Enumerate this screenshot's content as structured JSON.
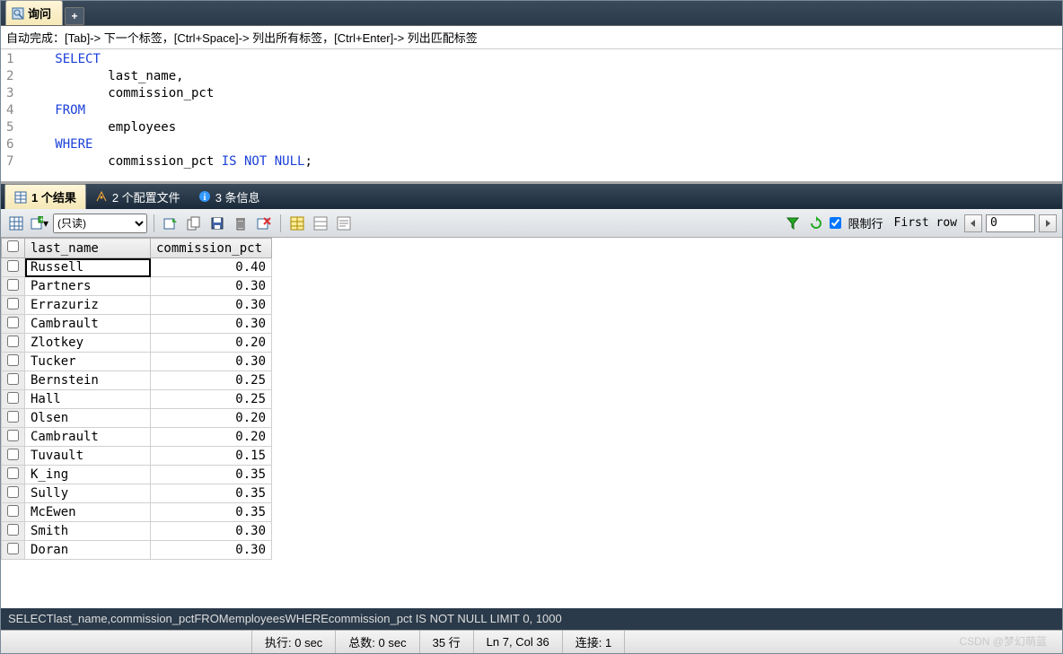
{
  "tabs": {
    "query_label": "询问"
  },
  "hint": "自动完成：[Tab]-> 下一个标签，[Ctrl+Space]-> 列出所有标签，[Ctrl+Enter]-> 列出匹配标签",
  "editor": {
    "lines": [
      "1",
      "2",
      "3",
      "4",
      "5",
      "6",
      "7"
    ],
    "code": [
      [
        {
          "t": "   "
        },
        {
          "t": "SELECT",
          "c": "kw"
        }
      ],
      [
        {
          "t": "          last_name,"
        }
      ],
      [
        {
          "t": "          commission_pct"
        }
      ],
      [
        {
          "t": "   "
        },
        {
          "t": "FROM",
          "c": "kw"
        }
      ],
      [
        {
          "t": "          employees"
        }
      ],
      [
        {
          "t": "   "
        },
        {
          "t": "WHERE",
          "c": "kw"
        }
      ],
      [
        {
          "t": "          commission_pct "
        },
        {
          "t": "IS NOT NULL",
          "c": "op"
        },
        {
          "t": ";"
        }
      ]
    ]
  },
  "result_tabs": {
    "results": "1 个结果",
    "profiles": "2 个配置文件",
    "messages": "3 条信息"
  },
  "toolbar": {
    "mode": "(只读)",
    "limit_label": "限制行",
    "first_row_label": "First row",
    "first_row_value": "0"
  },
  "grid": {
    "headers": {
      "c1": "last_name",
      "c2": "commission_pct"
    },
    "rows": [
      {
        "n": "Russell",
        "p": "0.40"
      },
      {
        "n": "Partners",
        "p": "0.30"
      },
      {
        "n": "Errazuriz",
        "p": "0.30"
      },
      {
        "n": "Cambrault",
        "p": "0.30"
      },
      {
        "n": "Zlotkey",
        "p": "0.20"
      },
      {
        "n": "Tucker",
        "p": "0.30"
      },
      {
        "n": "Bernstein",
        "p": "0.25"
      },
      {
        "n": "Hall",
        "p": "0.25"
      },
      {
        "n": "Olsen",
        "p": "0.20"
      },
      {
        "n": "Cambrault",
        "p": "0.20"
      },
      {
        "n": "Tuvault",
        "p": "0.15"
      },
      {
        "n": "K_ing",
        "p": "0.35"
      },
      {
        "n": "Sully",
        "p": "0.35"
      },
      {
        "n": "McEwen",
        "p": "0.35"
      },
      {
        "n": "Smith",
        "p": "0.30"
      },
      {
        "n": "Doran",
        "p": "0.30"
      }
    ]
  },
  "query_text": "SELECTlast_name,commission_pctFROMemployeesWHEREcommission_pct IS NOT NULL LIMIT 0, 1000",
  "status": {
    "exec": "执行: 0 sec",
    "total": "总数: 0 sec",
    "rows": "35 行",
    "pos": "Ln 7, Col 36",
    "conn": "连接: 1"
  },
  "watermark": "CSDN @梦幻萌蓝"
}
